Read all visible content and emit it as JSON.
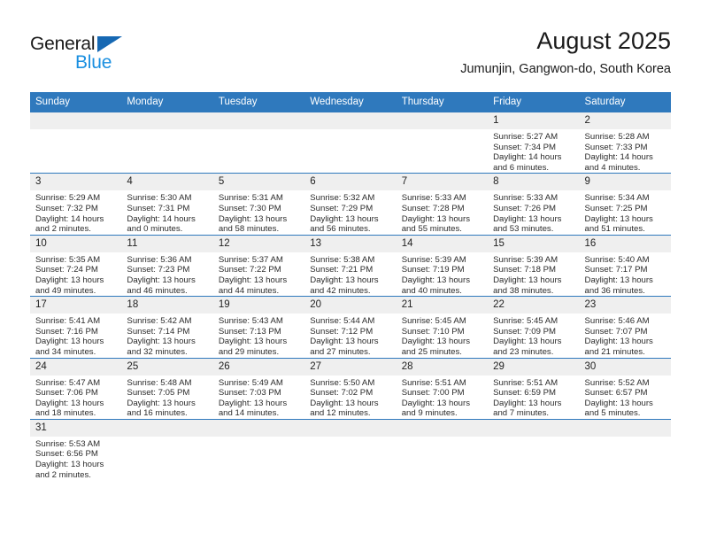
{
  "brand": {
    "name_top": "General",
    "name_bottom": "Blue",
    "accent_blue": "#1668b3",
    "light_blue": "#1a8fe0"
  },
  "header": {
    "title": "August 2025",
    "subtitle": "Jumunjin, Gangwon-do, South Korea"
  },
  "colors": {
    "header_row": "#2f79bd",
    "day_cell_header": "#efefef",
    "grid_line": "#2f79bd",
    "text": "#2b2b2b"
  },
  "weekdays": [
    "Sunday",
    "Monday",
    "Tuesday",
    "Wednesday",
    "Thursday",
    "Friday",
    "Saturday"
  ],
  "days": [
    {
      "date": "1",
      "sunrise": "Sunrise: 5:27 AM",
      "sunset": "Sunset: 7:34 PM",
      "daylight_line1": "Daylight: 14 hours",
      "daylight_line2": "and 6 minutes."
    },
    {
      "date": "2",
      "sunrise": "Sunrise: 5:28 AM",
      "sunset": "Sunset: 7:33 PM",
      "daylight_line1": "Daylight: 14 hours",
      "daylight_line2": "and 4 minutes."
    },
    {
      "date": "3",
      "sunrise": "Sunrise: 5:29 AM",
      "sunset": "Sunset: 7:32 PM",
      "daylight_line1": "Daylight: 14 hours",
      "daylight_line2": "and 2 minutes."
    },
    {
      "date": "4",
      "sunrise": "Sunrise: 5:30 AM",
      "sunset": "Sunset: 7:31 PM",
      "daylight_line1": "Daylight: 14 hours",
      "daylight_line2": "and 0 minutes."
    },
    {
      "date": "5",
      "sunrise": "Sunrise: 5:31 AM",
      "sunset": "Sunset: 7:30 PM",
      "daylight_line1": "Daylight: 13 hours",
      "daylight_line2": "and 58 minutes."
    },
    {
      "date": "6",
      "sunrise": "Sunrise: 5:32 AM",
      "sunset": "Sunset: 7:29 PM",
      "daylight_line1": "Daylight: 13 hours",
      "daylight_line2": "and 56 minutes."
    },
    {
      "date": "7",
      "sunrise": "Sunrise: 5:33 AM",
      "sunset": "Sunset: 7:28 PM",
      "daylight_line1": "Daylight: 13 hours",
      "daylight_line2": "and 55 minutes."
    },
    {
      "date": "8",
      "sunrise": "Sunrise: 5:33 AM",
      "sunset": "Sunset: 7:26 PM",
      "daylight_line1": "Daylight: 13 hours",
      "daylight_line2": "and 53 minutes."
    },
    {
      "date": "9",
      "sunrise": "Sunrise: 5:34 AM",
      "sunset": "Sunset: 7:25 PM",
      "daylight_line1": "Daylight: 13 hours",
      "daylight_line2": "and 51 minutes."
    },
    {
      "date": "10",
      "sunrise": "Sunrise: 5:35 AM",
      "sunset": "Sunset: 7:24 PM",
      "daylight_line1": "Daylight: 13 hours",
      "daylight_line2": "and 49 minutes."
    },
    {
      "date": "11",
      "sunrise": "Sunrise: 5:36 AM",
      "sunset": "Sunset: 7:23 PM",
      "daylight_line1": "Daylight: 13 hours",
      "daylight_line2": "and 46 minutes."
    },
    {
      "date": "12",
      "sunrise": "Sunrise: 5:37 AM",
      "sunset": "Sunset: 7:22 PM",
      "daylight_line1": "Daylight: 13 hours",
      "daylight_line2": "and 44 minutes."
    },
    {
      "date": "13",
      "sunrise": "Sunrise: 5:38 AM",
      "sunset": "Sunset: 7:21 PM",
      "daylight_line1": "Daylight: 13 hours",
      "daylight_line2": "and 42 minutes."
    },
    {
      "date": "14",
      "sunrise": "Sunrise: 5:39 AM",
      "sunset": "Sunset: 7:19 PM",
      "daylight_line1": "Daylight: 13 hours",
      "daylight_line2": "and 40 minutes."
    },
    {
      "date": "15",
      "sunrise": "Sunrise: 5:39 AM",
      "sunset": "Sunset: 7:18 PM",
      "daylight_line1": "Daylight: 13 hours",
      "daylight_line2": "and 38 minutes."
    },
    {
      "date": "16",
      "sunrise": "Sunrise: 5:40 AM",
      "sunset": "Sunset: 7:17 PM",
      "daylight_line1": "Daylight: 13 hours",
      "daylight_line2": "and 36 minutes."
    },
    {
      "date": "17",
      "sunrise": "Sunrise: 5:41 AM",
      "sunset": "Sunset: 7:16 PM",
      "daylight_line1": "Daylight: 13 hours",
      "daylight_line2": "and 34 minutes."
    },
    {
      "date": "18",
      "sunrise": "Sunrise: 5:42 AM",
      "sunset": "Sunset: 7:14 PM",
      "daylight_line1": "Daylight: 13 hours",
      "daylight_line2": "and 32 minutes."
    },
    {
      "date": "19",
      "sunrise": "Sunrise: 5:43 AM",
      "sunset": "Sunset: 7:13 PM",
      "daylight_line1": "Daylight: 13 hours",
      "daylight_line2": "and 29 minutes."
    },
    {
      "date": "20",
      "sunrise": "Sunrise: 5:44 AM",
      "sunset": "Sunset: 7:12 PM",
      "daylight_line1": "Daylight: 13 hours",
      "daylight_line2": "and 27 minutes."
    },
    {
      "date": "21",
      "sunrise": "Sunrise: 5:45 AM",
      "sunset": "Sunset: 7:10 PM",
      "daylight_line1": "Daylight: 13 hours",
      "daylight_line2": "and 25 minutes."
    },
    {
      "date": "22",
      "sunrise": "Sunrise: 5:45 AM",
      "sunset": "Sunset: 7:09 PM",
      "daylight_line1": "Daylight: 13 hours",
      "daylight_line2": "and 23 minutes."
    },
    {
      "date": "23",
      "sunrise": "Sunrise: 5:46 AM",
      "sunset": "Sunset: 7:07 PM",
      "daylight_line1": "Daylight: 13 hours",
      "daylight_line2": "and 21 minutes."
    },
    {
      "date": "24",
      "sunrise": "Sunrise: 5:47 AM",
      "sunset": "Sunset: 7:06 PM",
      "daylight_line1": "Daylight: 13 hours",
      "daylight_line2": "and 18 minutes."
    },
    {
      "date": "25",
      "sunrise": "Sunrise: 5:48 AM",
      "sunset": "Sunset: 7:05 PM",
      "daylight_line1": "Daylight: 13 hours",
      "daylight_line2": "and 16 minutes."
    },
    {
      "date": "26",
      "sunrise": "Sunrise: 5:49 AM",
      "sunset": "Sunset: 7:03 PM",
      "daylight_line1": "Daylight: 13 hours",
      "daylight_line2": "and 14 minutes."
    },
    {
      "date": "27",
      "sunrise": "Sunrise: 5:50 AM",
      "sunset": "Sunset: 7:02 PM",
      "daylight_line1": "Daylight: 13 hours",
      "daylight_line2": "and 12 minutes."
    },
    {
      "date": "28",
      "sunrise": "Sunrise: 5:51 AM",
      "sunset": "Sunset: 7:00 PM",
      "daylight_line1": "Daylight: 13 hours",
      "daylight_line2": "and 9 minutes."
    },
    {
      "date": "29",
      "sunrise": "Sunrise: 5:51 AM",
      "sunset": "Sunset: 6:59 PM",
      "daylight_line1": "Daylight: 13 hours",
      "daylight_line2": "and 7 minutes."
    },
    {
      "date": "30",
      "sunrise": "Sunrise: 5:52 AM",
      "sunset": "Sunset: 6:57 PM",
      "daylight_line1": "Daylight: 13 hours",
      "daylight_line2": "and 5 minutes."
    },
    {
      "date": "31",
      "sunrise": "Sunrise: 5:53 AM",
      "sunset": "Sunset: 6:56 PM",
      "daylight_line1": "Daylight: 13 hours",
      "daylight_line2": "and 2 minutes."
    }
  ],
  "grid": {
    "leading_blanks": 5,
    "trailing_blanks": 6
  }
}
